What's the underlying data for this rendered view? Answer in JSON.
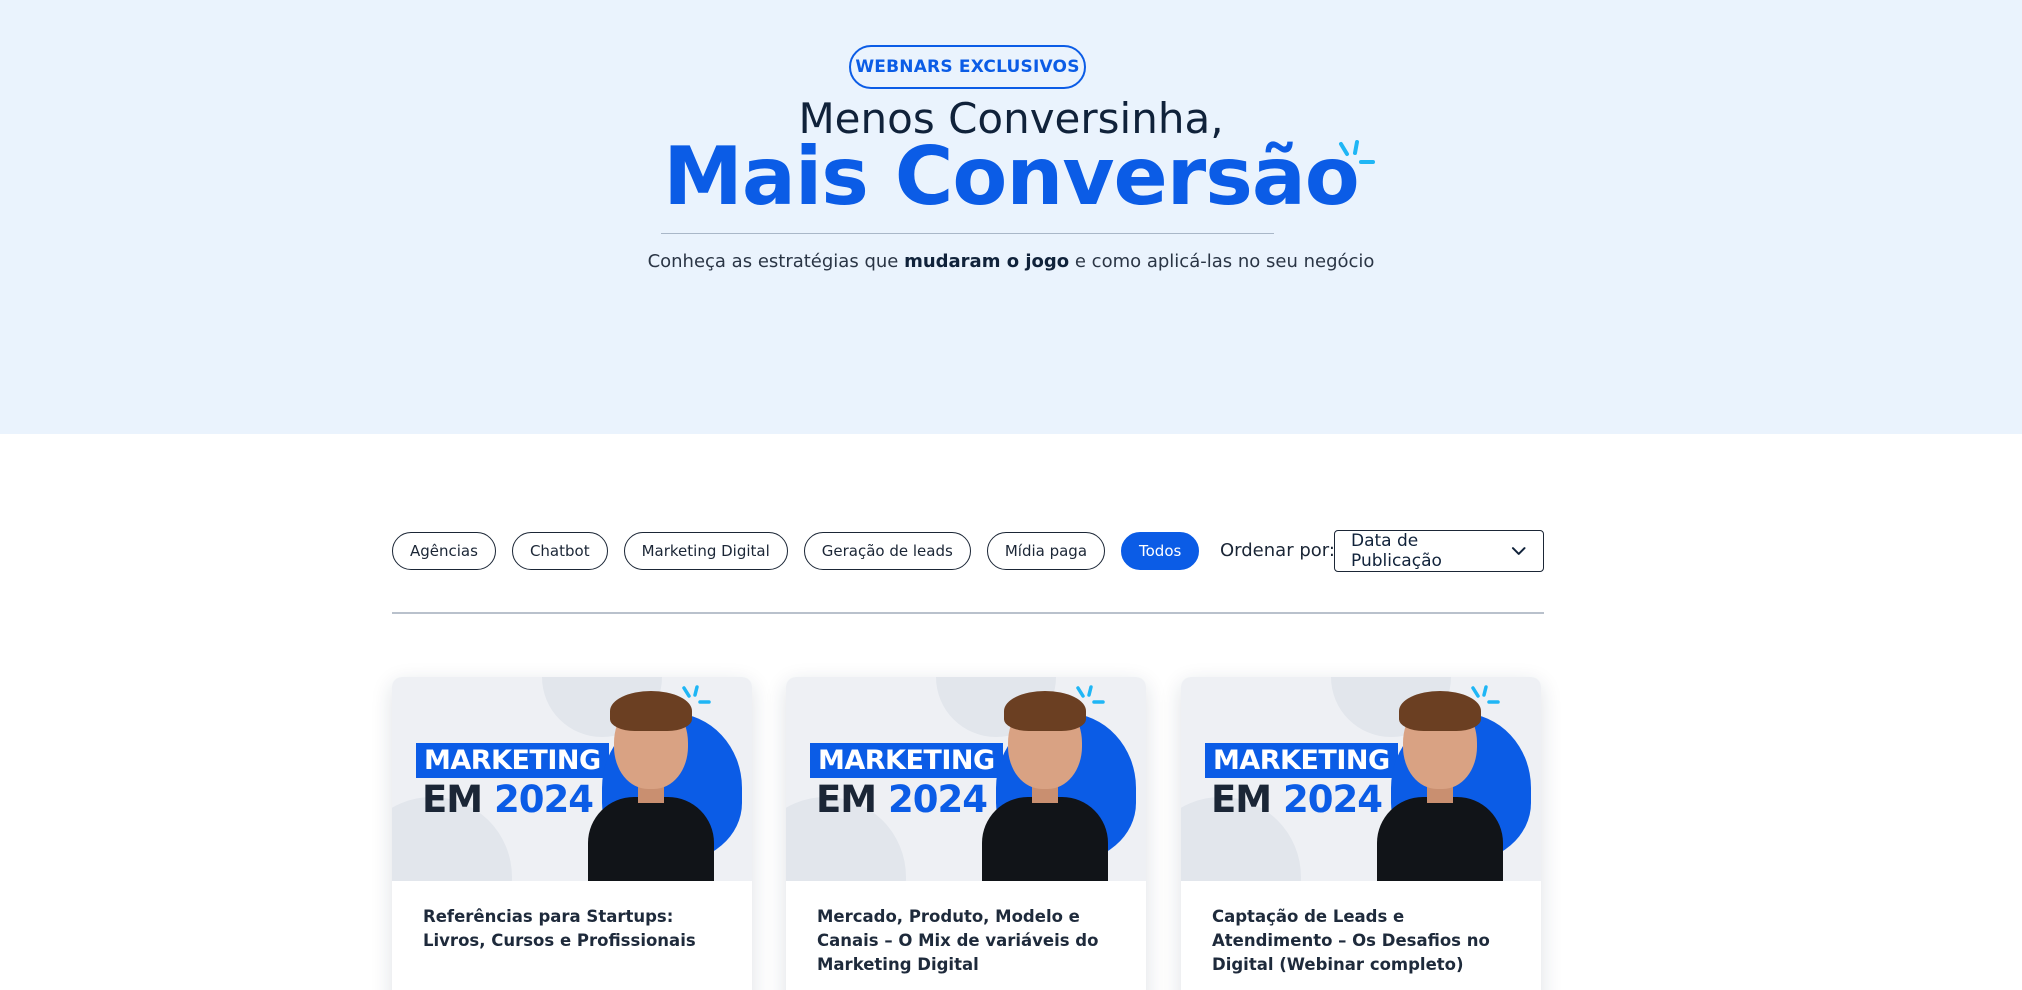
{
  "hero": {
    "badge": "WEBNARS EXCLUSIVOS",
    "line1": "Menos Conversinha,",
    "line2": "Mais Conversão",
    "subtitle_before": "Conheça as estratégias que ",
    "subtitle_bold": "mudaram o jogo",
    "subtitle_after": " e como aplicá-las no seu negócio"
  },
  "filters": [
    {
      "label": "Agências",
      "active": false
    },
    {
      "label": "Chatbot",
      "active": false
    },
    {
      "label": "Marketing Digital",
      "active": false
    },
    {
      "label": "Geração de leads",
      "active": false
    },
    {
      "label": "Mídia paga",
      "active": false
    },
    {
      "label": "Todos",
      "active": true
    }
  ],
  "sort": {
    "label": "Ordenar por:",
    "selected": "Data de Publicação"
  },
  "thumbnail": {
    "line1": "MARKETING",
    "line2_prefix": "EM ",
    "line2_year": "2024"
  },
  "cards": [
    {
      "title": "Referências para Startups: Livros, Cursos e Profissionais"
    },
    {
      "title": "Mercado, Produto, Modelo e Canais – O Mix de variáveis do Marketing Digital"
    },
    {
      "title": "Captação de Leads e Atendimento – Os Desafios no Digital (Webinar completo)"
    }
  ],
  "colors": {
    "accent": "#0b5ce6",
    "hero_bg": "#eaf3fd",
    "spark": "#1fb6f5",
    "text_dark": "#10223a"
  }
}
